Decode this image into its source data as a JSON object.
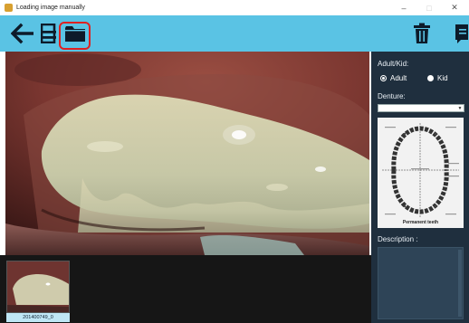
{
  "window": {
    "title": "Loading image manually",
    "minimize_symbol": "–",
    "maximize_symbol": "□",
    "close_symbol": "✕"
  },
  "toolbar": {
    "buttons": [
      {
        "name": "back",
        "icon": "arrow-left-icon"
      },
      {
        "name": "list",
        "icon": "list-icon"
      },
      {
        "name": "open-folder",
        "icon": "folder-icon",
        "highlighted": true
      },
      {
        "name": "delete",
        "icon": "trash-icon"
      },
      {
        "name": "report",
        "icon": "document-icon"
      }
    ],
    "colors": {
      "background": "#5ac3e4",
      "icon": "#0d1b2a",
      "highlight": "#e02020"
    }
  },
  "viewer": {
    "thumbnails": [
      {
        "label": "201400749_0",
        "selected": true
      }
    ]
  },
  "panel": {
    "patient_type_label": "Adult/Kid:",
    "options": [
      {
        "label": "Adult",
        "selected": true
      },
      {
        "label": "Kid",
        "selected": false
      }
    ],
    "denture_label": "Denture:",
    "denture_value": "",
    "tooth_chart_caption": "Permanent teeth",
    "description_label": "Description :",
    "description_value": "",
    "colors": {
      "background": "#1f2f3e",
      "text": "#e8eef4",
      "field": "#2e4457"
    }
  }
}
